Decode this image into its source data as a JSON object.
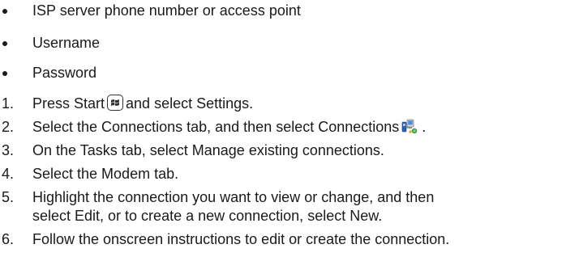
{
  "requirements": [
    "ISP server phone number or access point",
    "Username",
    "Password"
  ],
  "steps": [
    {
      "number": "1.",
      "before": "Press Start",
      "after": "and select Settings.",
      "icon": "windows-start-icon"
    },
    {
      "number": "2.",
      "before": "Select the Connections tab, and then select Connections",
      "after": ".",
      "icon": "connections-icon"
    },
    {
      "number": "3.",
      "text": "On the Tasks tab, select Manage existing connections."
    },
    {
      "number": "4.",
      "text": "Select the Modem tab."
    },
    {
      "number": "5.",
      "line1": "Highlight the connection you want to view or change, and then",
      "line2": "select Edit, or to create a new connection, select New."
    },
    {
      "number": "6.",
      "text": "Follow the onscreen instructions to edit or create the connection."
    }
  ]
}
